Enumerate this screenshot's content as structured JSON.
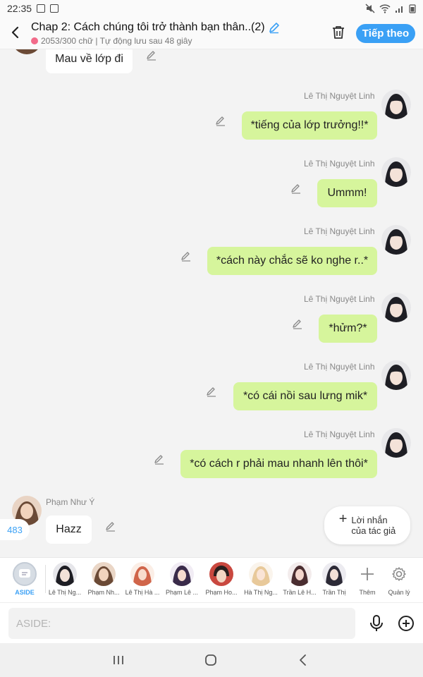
{
  "status_bar": {
    "time": "22:35"
  },
  "header": {
    "title": "Chap 2: Cách chúng tôi trở thành bạn thân..(2)",
    "subtitle": "2053/300 chữ | Tự động lưu sau 48 giây",
    "follow_label": "Tiếp theo"
  },
  "messages": [
    {
      "side": "left",
      "text": "Mau về lớp đi"
    },
    {
      "side": "right",
      "sender": "Lê Thị Nguyệt Linh",
      "text": "*tiếng của lớp trưởng!!*"
    },
    {
      "side": "right",
      "sender": "Lê Thị Nguyệt Linh",
      "text": "Ummm!"
    },
    {
      "side": "right",
      "sender": "Lê Thị Nguyệt Linh",
      "text": "*cách này chắc sẽ ko nghe r..*"
    },
    {
      "side": "right",
      "sender": "Lê Thị Nguyệt Linh",
      "text": "*hửm?*"
    },
    {
      "side": "right",
      "sender": "Lê Thị Nguyệt Linh",
      "text": "*có cái nồi sau lưng mik*"
    },
    {
      "side": "right",
      "sender": "Lê Thị Nguyệt Linh",
      "text": "*có cách r phải mau nhanh lên thôi*"
    },
    {
      "side": "left",
      "sender": "Phạm Như Ý",
      "text": "Hazz"
    }
  ],
  "count_badge": "483",
  "author_note": {
    "line1": "Lời nhắn",
    "line2": "của tác giả"
  },
  "characters": [
    {
      "label": "ASIDE"
    },
    {
      "label": "Lê Thị Ng..."
    },
    {
      "label": "Phạm Nh..."
    },
    {
      "label": "Lê Thị Hà ..."
    },
    {
      "label": "Phạm Lê ..."
    },
    {
      "label": "Phạm Ho..."
    },
    {
      "label": "Hà Thị Ng..."
    },
    {
      "label": "Trần Lê H..."
    },
    {
      "label": "Trần Thị"
    },
    {
      "label": "Thêm"
    },
    {
      "label": "Quản lý"
    }
  ],
  "input": {
    "placeholder": "ASIDE:"
  },
  "colors": {
    "accent": "#3aa0f5",
    "bubble_right": "#d6f59c",
    "bubble_left": "#ffffff"
  }
}
